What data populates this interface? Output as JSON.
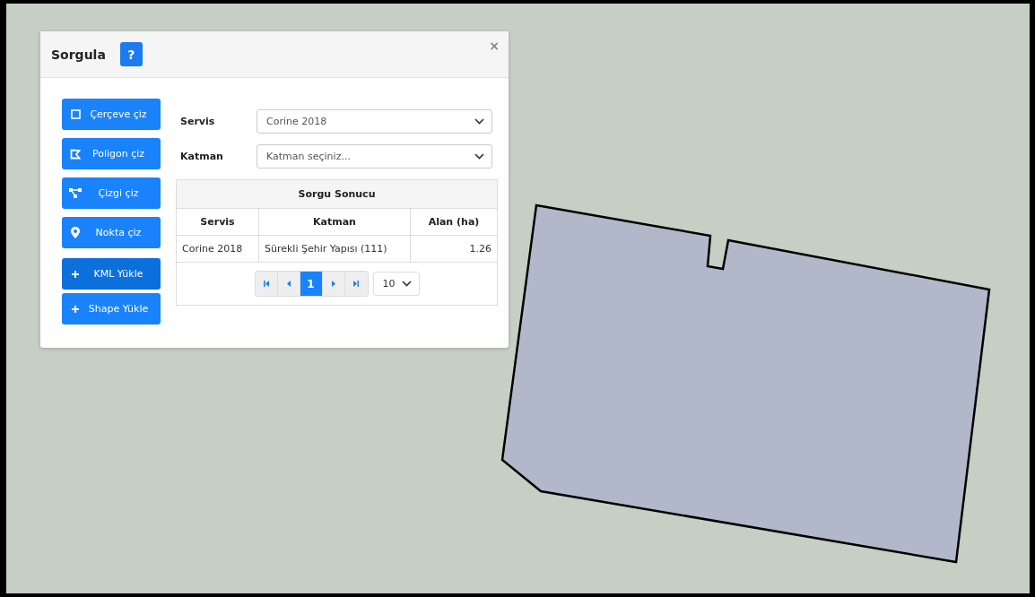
{
  "dialog": {
    "title": "Sorgula",
    "help_label": "?",
    "close_label": "×"
  },
  "tools": [
    {
      "kind": "frame",
      "label": "Çerçeve çiz",
      "selected": false
    },
    {
      "kind": "polygon",
      "label": "Poligon çiz",
      "selected": false
    },
    {
      "kind": "line",
      "label": "Çizgi çiz",
      "selected": false
    },
    {
      "kind": "point",
      "label": "Nokta çiz",
      "selected": false
    },
    {
      "kind": "upload",
      "label": "KML Yükle",
      "selected": true
    },
    {
      "kind": "upload",
      "label": "Shape Yükle",
      "selected": false
    }
  ],
  "form": [
    {
      "label": "Servis",
      "value": "Corine 2018"
    },
    {
      "label": "Katman",
      "placeholder": "Katman seçiniz..."
    }
  ],
  "result_table": {
    "title": "Sorgu Sonucu",
    "columns": [
      "Servis",
      "Katman",
      "Alan (ha)"
    ],
    "rows": [
      [
        "Corine 2018",
        "Sürekli Şehir Yapısı (111)",
        "1.26"
      ]
    ],
    "pages": [
      {
        "label": "1",
        "selected": true
      }
    ],
    "page_size": "10"
  }
}
